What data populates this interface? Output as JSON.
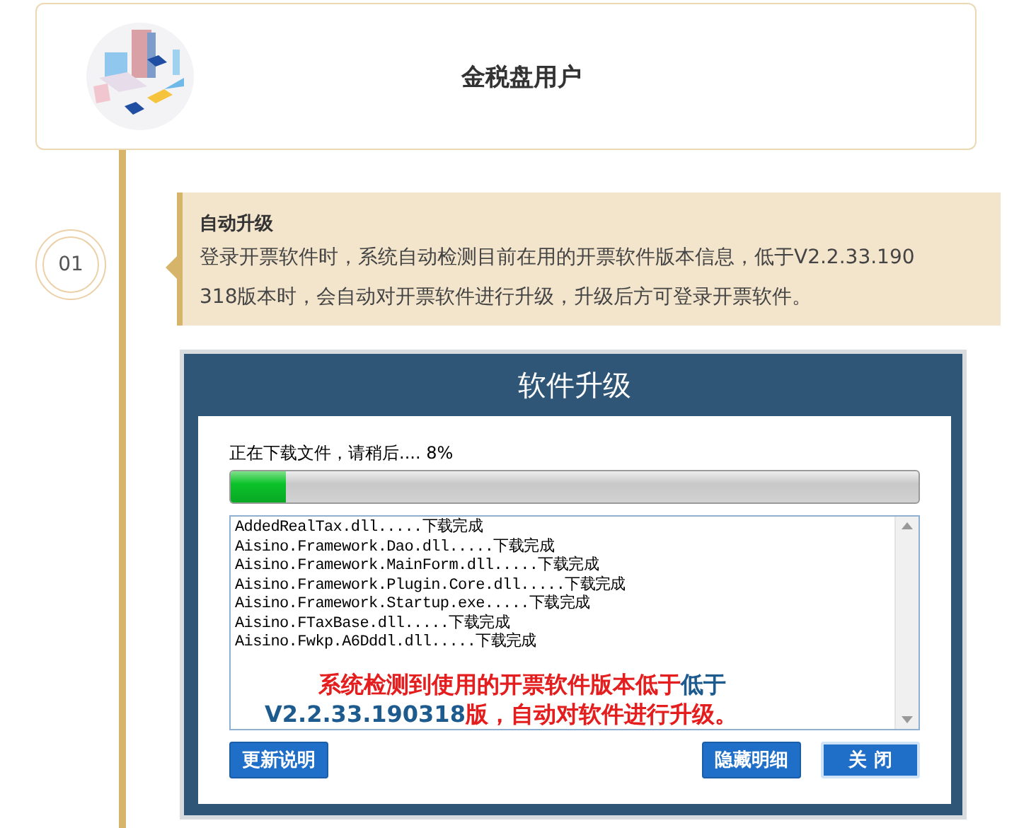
{
  "header": {
    "title": "金税盘用户"
  },
  "step": {
    "number": "01",
    "title": "自动升级",
    "body": "登录开票软件时，系统自动检测目前在用的开票软件版本信息，低于V2.2.33.190318版本时，会自动对开票软件进行升级，升级后方可登录开票软件。"
  },
  "dialog": {
    "title": "软件升级",
    "status": "正在下载文件，请稍后.... 8%",
    "progress": {
      "level": 0.08
    },
    "log": [
      "AddedRealTax.dll.....下载完成",
      "Aisino.Framework.Dao.dll.....下载完成",
      "Aisino.Framework.MainForm.dll.....下载完成",
      "Aisino.Framework.Plugin.Core.dll.....下载完成",
      "Aisino.Framework.Startup.exe.....下载完成",
      "Aisino.FTaxBase.dll.....下载完成",
      "Aisino.Fwkp.A6Dddl.dll.....下载完成"
    ],
    "notice": [
      [
        {
          "text": "系统检测到使用的开票软件版本低于",
          "color": "#e41e1e"
        },
        {
          "text": "低于",
          "color": "#1d5b8f"
        }
      ],
      [
        {
          "text": "V2.2.33.190318",
          "color": "#1d5b8f"
        },
        {
          "text": "版，自动对软件进行升级。",
          "color": "#e41e1e"
        }
      ]
    ],
    "buttons": [
      {
        "label": "更新说明",
        "default": false
      },
      {
        "label": "隐藏明细",
        "default": false
      },
      {
        "label": "关 闭",
        "default": true
      }
    ]
  }
}
